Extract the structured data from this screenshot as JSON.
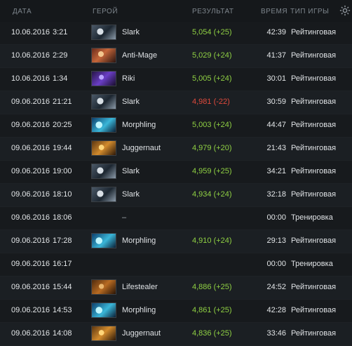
{
  "header": {
    "date": "ДАТА",
    "hero": "ГЕРОЙ",
    "result": "РЕЗУЛЬТАТ",
    "duration": "ВРЕМЯ",
    "type": "ТИП ИГРЫ",
    "settings_icon": "gear-icon"
  },
  "matches": [
    {
      "date": "10.06.2016",
      "time": "3:21",
      "hero": "Slark",
      "portrait": "slark",
      "result": "5,054 (+25)",
      "outcome": "win",
      "duration": "42:39",
      "type": "Рейтинговая"
    },
    {
      "date": "10.06.2016",
      "time": "2:29",
      "hero": "Anti-Mage",
      "portrait": "antimage",
      "result": "5,029 (+24)",
      "outcome": "win",
      "duration": "41:37",
      "type": "Рейтинговая"
    },
    {
      "date": "10.06.2016",
      "time": "1:34",
      "hero": "Riki",
      "portrait": "riki",
      "result": "5,005 (+24)",
      "outcome": "win",
      "duration": "30:01",
      "type": "Рейтинговая"
    },
    {
      "date": "09.06.2016",
      "time": "21:21",
      "hero": "Slark",
      "portrait": "slark",
      "result": "4,981 (-22)",
      "outcome": "loss",
      "duration": "30:59",
      "type": "Рейтинговая"
    },
    {
      "date": "09.06.2016",
      "time": "20:25",
      "hero": "Morphling",
      "portrait": "morphling",
      "result": "5,003 (+24)",
      "outcome": "win",
      "duration": "44:47",
      "type": "Рейтинговая"
    },
    {
      "date": "09.06.2016",
      "time": "19:44",
      "hero": "Juggernaut",
      "portrait": "juggernaut",
      "result": "4,979 (+20)",
      "outcome": "win",
      "duration": "21:43",
      "type": "Рейтинговая"
    },
    {
      "date": "09.06.2016",
      "time": "19:00",
      "hero": "Slark",
      "portrait": "slark",
      "result": "4,959 (+25)",
      "outcome": "win",
      "duration": "34:21",
      "type": "Рейтинговая"
    },
    {
      "date": "09.06.2016",
      "time": "18:10",
      "hero": "Slark",
      "portrait": "slark",
      "result": "4,934 (+24)",
      "outcome": "win",
      "duration": "32:18",
      "type": "Рейтинговая"
    },
    {
      "date": "09.06.2016",
      "time": "18:06",
      "hero": "–",
      "portrait": "",
      "result": "",
      "outcome": "none",
      "duration": "00:00",
      "type": "Тренировка"
    },
    {
      "date": "09.06.2016",
      "time": "17:28",
      "hero": "Morphling",
      "portrait": "morphling",
      "result": "4,910 (+24)",
      "outcome": "win",
      "duration": "29:13",
      "type": "Рейтинговая"
    },
    {
      "date": "09.06.2016",
      "time": "16:17",
      "hero": "",
      "portrait": "",
      "result": "",
      "outcome": "none",
      "duration": "00:00",
      "type": "Тренировка"
    },
    {
      "date": "09.06.2016",
      "time": "15:44",
      "hero": "Lifestealer",
      "portrait": "lifestealer",
      "result": "4,886 (+25)",
      "outcome": "win",
      "duration": "24:52",
      "type": "Рейтинговая"
    },
    {
      "date": "09.06.2016",
      "time": "14:53",
      "hero": "Morphling",
      "portrait": "morphling",
      "result": "4,861 (+25)",
      "outcome": "win",
      "duration": "42:28",
      "type": "Рейтинговая"
    },
    {
      "date": "09.06.2016",
      "time": "14:08",
      "hero": "Juggernaut",
      "portrait": "juggernaut",
      "result": "4,836 (+25)",
      "outcome": "win",
      "duration": "33:46",
      "type": "Рейтинговая"
    }
  ],
  "colors": {
    "win": "#8fd043",
    "loss": "#e04a3c"
  }
}
